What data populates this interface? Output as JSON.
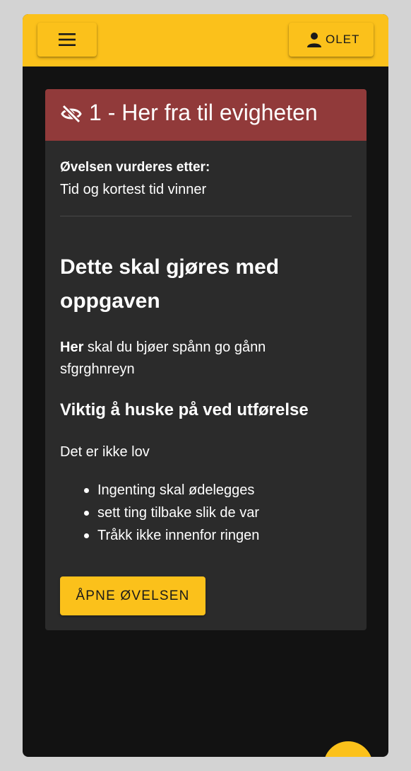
{
  "header": {
    "menu_icon": "menu-icon",
    "user_icon": "person-icon",
    "user_label": "OLET",
    "accent_color": "#fbc11b"
  },
  "card": {
    "header_color": "#913a3a",
    "visibility_icon": "eye-off-icon",
    "title": "1 - Her fra til evigheten",
    "evaluation_label": "Øvelsen vurderes etter:",
    "evaluation_value": "Tid og kortest tid vinner",
    "section_title": "Dette skal gjøres med oppgaven",
    "description_bold": "Her",
    "description_rest": " skal du bjøer spånn go gånn sfgrghnreyn",
    "important_title": "Viktig å huske på ved utførelse",
    "rules_intro": "Det er ikke lov",
    "rules": [
      "Ingenting skal ødelegges",
      "sett ting tilbake slik de var",
      "Tråkk ikke innenfor ringen"
    ],
    "open_button": "ÅPNE ØVELSEN"
  },
  "fab": {
    "icon": "fab-button"
  }
}
